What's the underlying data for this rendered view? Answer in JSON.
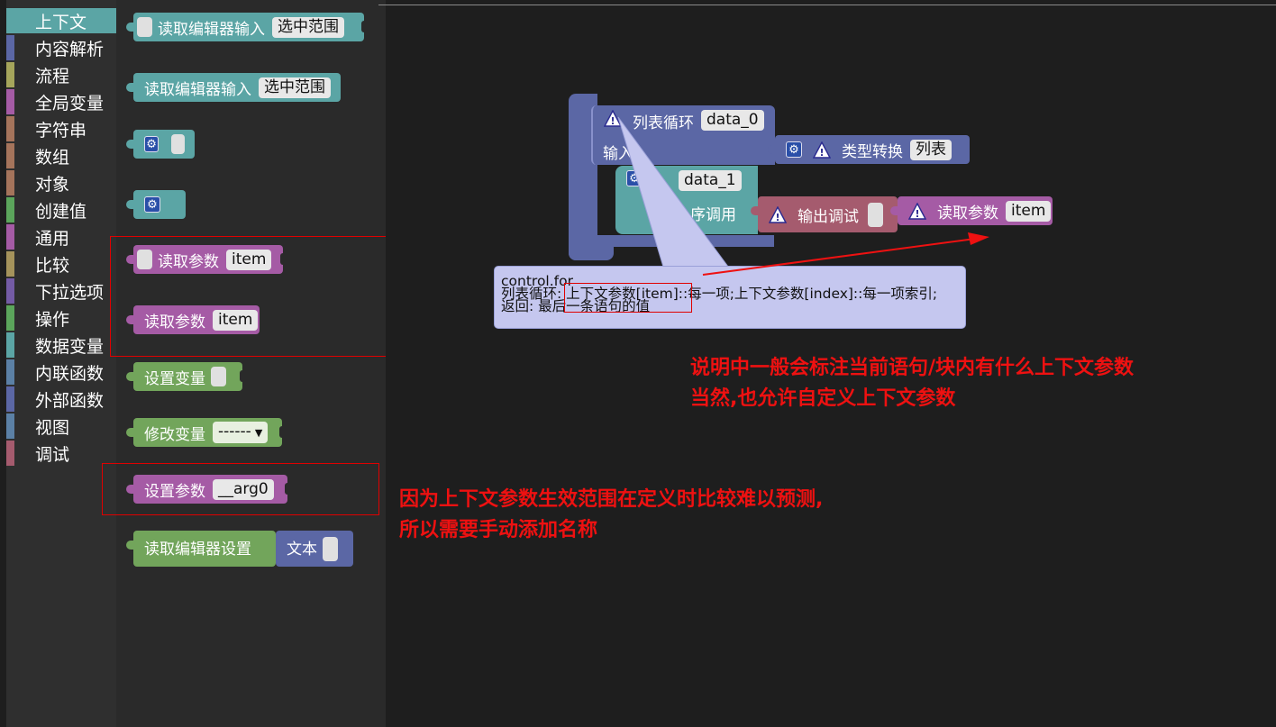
{
  "toolbox": {
    "categories": [
      {
        "label": "上下文",
        "color": "#5ba5a5",
        "selected": true
      },
      {
        "label": "内容解析",
        "color": "#5b67a5"
      },
      {
        "label": "流程",
        "color": "#a5a55b"
      },
      {
        "label": "全局变量",
        "color": "#a55ba5"
      },
      {
        "label": "字符串",
        "color": "#a5745b"
      },
      {
        "label": "数组",
        "color": "#a5745b"
      },
      {
        "label": "对象",
        "color": "#a5745b"
      },
      {
        "label": "创建值",
        "color": "#5ba55b"
      },
      {
        "label": "通用",
        "color": "#a55ba5"
      },
      {
        "label": "比较",
        "color": "#a5935b"
      },
      {
        "label": "下拉选项",
        "color": "#745ba5"
      },
      {
        "label": "操作",
        "color": "#5ba55b"
      },
      {
        "label": "数据变量",
        "color": "#5ba5a5"
      },
      {
        "label": "内联函数",
        "color": "#5b80a5"
      },
      {
        "label": "外部函数",
        "color": "#5b67a5"
      },
      {
        "label": "视图",
        "color": "#5b80a5"
      },
      {
        "label": "调试",
        "color": "#a55b6e"
      }
    ]
  },
  "flyout": {
    "read_editor_input": "读取编辑器输入",
    "selection_range": "选中范围",
    "read_param": "读取参数",
    "item": "item",
    "set_variable": "设置变量",
    "modify_variable": "修改变量",
    "modify_dropdown": "------",
    "set_param": "设置参数",
    "arg_name": "__arg0",
    "read_editor_settings": "读取编辑器设置",
    "text": "文本"
  },
  "workspace": {
    "list_loop": "列表循环",
    "data0": "data_0",
    "input_label": "输入",
    "type_convert": "类型转换",
    "list": "列表",
    "data1": "data_1",
    "seq_call": "序调用",
    "debug_output": "输出调试",
    "read_param": "读取参数",
    "item": "item"
  },
  "tooltip": {
    "line1": "control.for",
    "line2": "列表循环: 上下文参数[item]::每一项;上下文参数[index]::每一项索引;",
    "line3": "返回: 最后一条语句的值"
  },
  "notes": {
    "note1_line1": "说明中一般会标注当前语句/块内有什么上下文参数",
    "note1_line2": "当然,也允许自定义上下文参数",
    "note2_line1": "因为上下文参数生效范围在定义时比较难以预测,",
    "note2_line2": "所以需要手动添加名称"
  },
  "colors": {
    "teal": "#5ba5a5",
    "purple": "#a55ba5",
    "green": "#72a55b",
    "indigo": "#5b67a5",
    "rose": "#a55b6e",
    "annotation_red": "#ee1111"
  }
}
